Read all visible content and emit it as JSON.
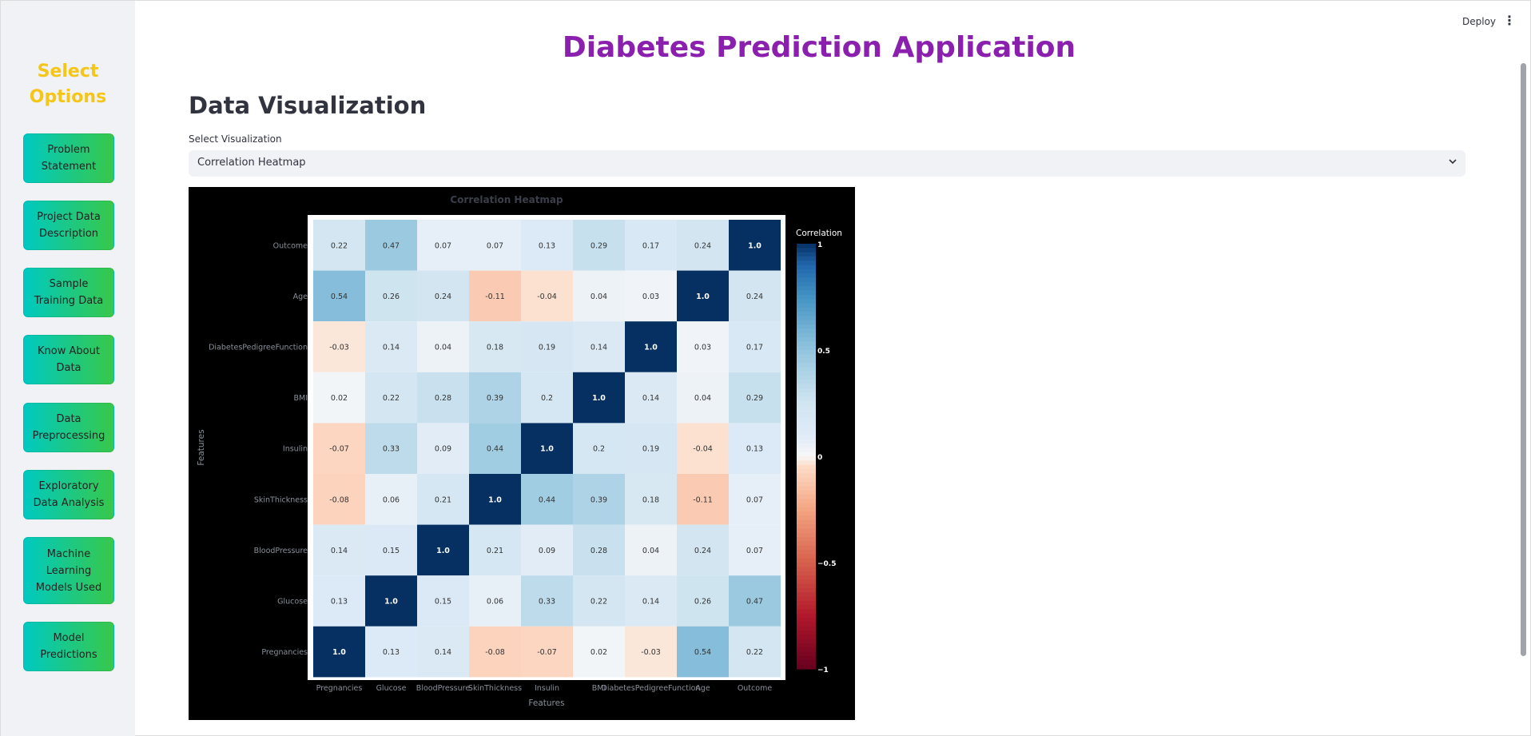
{
  "sidebar": {
    "title": "Select Options",
    "items": [
      {
        "label": "Problem Statement"
      },
      {
        "label": "Project Data Description"
      },
      {
        "label": "Sample Training Data"
      },
      {
        "label": "Know About Data"
      },
      {
        "label": "Data Preprocessing"
      },
      {
        "label": "Exploratory Data Analysis"
      },
      {
        "label": "Machine Learning Models Used"
      },
      {
        "label": "Model Predictions"
      }
    ],
    "colors": {
      "title": "#f5c518",
      "button_start": "#00c9c0",
      "button_end": "#38c84a"
    }
  },
  "topbar": {
    "deploy_label": "Deploy",
    "menu_icon": "vertical-dots-icon"
  },
  "main": {
    "app_title": "Diabetes Prediction Application",
    "section_title": "Data Visualization",
    "select_label": "Select Visualization",
    "select_value": "Correlation Heatmap",
    "select_icon": "chevron-down-icon",
    "colors": {
      "app_title": "#8b1fae"
    }
  },
  "chart_data": {
    "type": "heatmap",
    "title": "Correlation Heatmap",
    "xlabel": "Features",
    "ylabel": "Features",
    "x_categories": [
      "Pregnancies",
      "Glucose",
      "BloodPressure",
      "SkinThickness",
      "Insulin",
      "BMI",
      "DiabetesPedigreeFunction",
      "Age",
      "Outcome"
    ],
    "y_categories_top_to_bottom": [
      "Outcome",
      "Age",
      "DiabetesPedigreeFunction",
      "BMI",
      "Insulin",
      "SkinThickness",
      "BloodPressure",
      "Glucose",
      "Pregnancies"
    ],
    "values_top_to_bottom": [
      [
        "0.22",
        "0.47",
        "0.07",
        "0.07",
        "0.13",
        "0.29",
        "0.17",
        "0.24",
        "1.0"
      ],
      [
        "0.54",
        "0.26",
        "0.24",
        "-0.11",
        "-0.04",
        "0.04",
        "0.03",
        "1.0",
        "0.24"
      ],
      [
        "-0.03",
        "0.14",
        "0.04",
        "0.18",
        "0.19",
        "0.14",
        "1.0",
        "0.03",
        "0.17"
      ],
      [
        "0.02",
        "0.22",
        "0.28",
        "0.39",
        "0.2",
        "1.0",
        "0.14",
        "0.04",
        "0.29"
      ],
      [
        "-0.07",
        "0.33",
        "0.09",
        "0.44",
        "1.0",
        "0.2",
        "0.19",
        "-0.04",
        "0.13"
      ],
      [
        "-0.08",
        "0.06",
        "0.21",
        "1.0",
        "0.44",
        "0.39",
        "0.18",
        "-0.11",
        "0.07"
      ],
      [
        "0.14",
        "0.15",
        "1.0",
        "0.21",
        "0.09",
        "0.28",
        "0.04",
        "0.24",
        "0.07"
      ],
      [
        "0.13",
        "1.0",
        "0.15",
        "0.06",
        "0.33",
        "0.22",
        "0.14",
        "0.26",
        "0.47"
      ],
      [
        "1.0",
        "0.13",
        "0.14",
        "-0.08",
        "-0.07",
        "0.02",
        "-0.03",
        "0.54",
        "0.22"
      ]
    ],
    "colorbar": {
      "title": "Correlation",
      "range": [
        -1,
        1
      ],
      "ticks": [
        "1",
        "0.5",
        "0",
        "−0.5",
        "−1"
      ],
      "colorscale": "RdBu"
    },
    "background": "#000000"
  }
}
